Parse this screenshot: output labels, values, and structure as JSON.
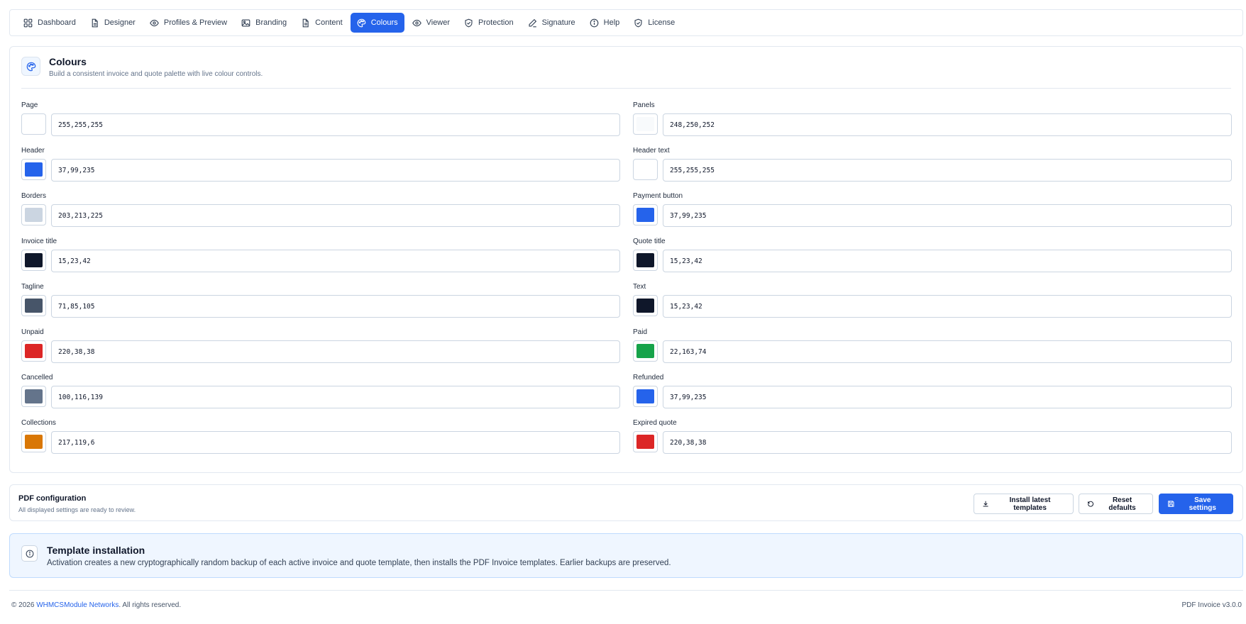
{
  "nav": {
    "items": [
      {
        "label": "Dashboard",
        "icon": "grid-icon"
      },
      {
        "label": "Designer",
        "icon": "file-icon"
      },
      {
        "label": "Profiles & Preview",
        "icon": "eye-icon"
      },
      {
        "label": "Branding",
        "icon": "image-icon"
      },
      {
        "label": "Content",
        "icon": "file-text-icon"
      },
      {
        "label": "Colours",
        "icon": "palette-icon",
        "active": true
      },
      {
        "label": "Viewer",
        "icon": "eye-icon"
      },
      {
        "label": "Protection",
        "icon": "shield-check-icon"
      },
      {
        "label": "Signature",
        "icon": "pen-icon"
      },
      {
        "label": "Help",
        "icon": "info-icon"
      },
      {
        "label": "License",
        "icon": "shield-check-icon"
      }
    ]
  },
  "colours": {
    "title": "Colours",
    "subtitle": "Build a consistent invoice and quote palette with live colour controls.",
    "fields": [
      {
        "label": "Page",
        "value": "255,255,255",
        "color": "#ffffff"
      },
      {
        "label": "Panels",
        "value": "248,250,252",
        "color": "#f8fafc"
      },
      {
        "label": "Header",
        "value": "37,99,235",
        "color": "#2563eb"
      },
      {
        "label": "Header text",
        "value": "255,255,255",
        "color": "#ffffff"
      },
      {
        "label": "Borders",
        "value": "203,213,225",
        "color": "#cbd5e1"
      },
      {
        "label": "Payment button",
        "value": "37,99,235",
        "color": "#2563eb"
      },
      {
        "label": "Invoice title",
        "value": "15,23,42",
        "color": "#0f172a"
      },
      {
        "label": "Quote title",
        "value": "15,23,42",
        "color": "#0f172a"
      },
      {
        "label": "Tagline",
        "value": "71,85,105",
        "color": "#475569"
      },
      {
        "label": "Text",
        "value": "15,23,42",
        "color": "#0f172a"
      },
      {
        "label": "Unpaid",
        "value": "220,38,38",
        "color": "#dc2626"
      },
      {
        "label": "Paid",
        "value": "22,163,74",
        "color": "#16a34a"
      },
      {
        "label": "Cancelled",
        "value": "100,116,139",
        "color": "#64748b"
      },
      {
        "label": "Refunded",
        "value": "37,99,235",
        "color": "#2563eb"
      },
      {
        "label": "Collections",
        "value": "217,119,6",
        "color": "#d97706"
      },
      {
        "label": "Expired quote",
        "value": "220,38,38",
        "color": "#dc2626"
      }
    ]
  },
  "pdf": {
    "title": "PDF configuration",
    "subtitle": "All displayed settings are ready to review.",
    "install_label": "Install latest templates",
    "reset_label": "Reset defaults",
    "save_label": "Save settings"
  },
  "info": {
    "title": "Template installation",
    "text": "Activation creates a new cryptographically random backup of each active invoice and quote template, then installs the PDF Invoice templates. Earlier backups are preserved."
  },
  "footer": {
    "copyright": "© 2026",
    "brand": "WHMCSModule Networks",
    "rights": ". All rights reserved.",
    "version": "PDF Invoice v3.0.0"
  },
  "accent": "#2563eb"
}
